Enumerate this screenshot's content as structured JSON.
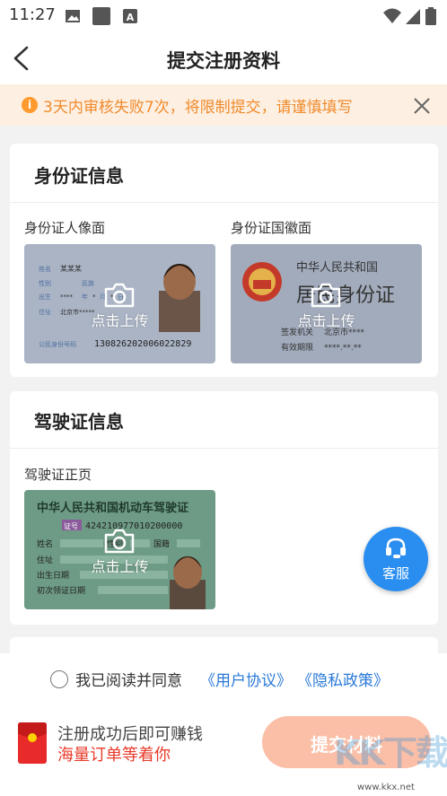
{
  "status_bar": {
    "time": "11:27"
  },
  "header": {
    "title": "提交注册资料"
  },
  "notice": {
    "icon_text": "i",
    "text": "3天内审核失败7次，将限制提交，请谨慎填写"
  },
  "id_section": {
    "title": "身份证信息",
    "front_label": "身份证人像面",
    "back_label": "身份证国徽面",
    "front_card": {
      "name_label": "姓名",
      "name_value": "某某某",
      "sex_label": "性别",
      "nation_label": "民族",
      "birth_label": "出生",
      "year_label": "年",
      "month_label": "月",
      "day_label": "日",
      "address_label": "住址",
      "address_value": "北京市*****",
      "id_label": "公民身份号码",
      "id_value": "130826202006022829"
    },
    "back_card": {
      "country": "中华人民共和国",
      "doc_name": "居民身份证",
      "authority_label": "签发机关",
      "authority_value": "北京市****",
      "validity_label": "有效期限",
      "validity_value": "****.**.**"
    }
  },
  "license_section": {
    "title": "驾驶证信息",
    "front_label": "驾驶证正页",
    "card": {
      "title": "中华人民共和国机动车驾驶证",
      "badge": "证号",
      "number": "424210977010200000",
      "name_label": "姓名",
      "sex_label": "性别",
      "nationality_label": "国籍",
      "address_label": "住址",
      "birth_label": "出生日期",
      "first_issue_label": "初次领证日期"
    }
  },
  "upload_text": "点击上传",
  "service": {
    "label": "客服"
  },
  "agreement": {
    "prefix": "我已阅读并同意",
    "user_link": "《用户协议》",
    "privacy_link": "《隐私政策》"
  },
  "promo": {
    "line1": "注册成功后即可赚钱",
    "line2": "海量订单等着你"
  },
  "submit": {
    "label": "提交材料"
  },
  "watermark": {
    "text": "KK下载",
    "url": "www.kkx.net"
  },
  "colors": {
    "accent": "#2a8ef0",
    "warning": "#f08a2c",
    "link": "#2a79d8",
    "submit_bg": "#fbbfa8",
    "promo_red": "#e83a2a"
  }
}
